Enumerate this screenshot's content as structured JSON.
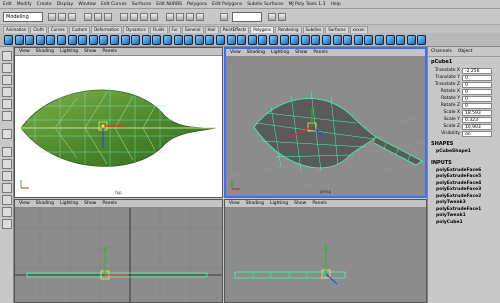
{
  "menu": [
    "Edit",
    "Modify",
    "Create",
    "Display",
    "Window",
    "Edit Curves",
    "Surfaces",
    "Edit NURBS",
    "Polygons",
    "Edit Polygons",
    "Subdiv Surfaces",
    "MJ Poly Tools 1.3",
    "Help"
  ],
  "mode": "Modeling",
  "shelf_tabs": [
    "Animation",
    "Cloth",
    "Curves",
    "Custom",
    "Deformation",
    "Dynamics",
    "Fluids",
    "Fur",
    "General",
    "Hair",
    "PaintEffects",
    "Polygons",
    "Rendering",
    "Subdivs",
    "Surfaces",
    "xxxxn"
  ],
  "active_shelf_tab": "Polygons",
  "viewport_menu": [
    "View",
    "Shading",
    "Lighting",
    "Show",
    "Panels"
  ],
  "viewports": {
    "top_left_label": "top",
    "top_right_label": "persp"
  },
  "channel_box": {
    "tabs": [
      "Channels",
      "Object"
    ],
    "object": "pCube1",
    "attributes": [
      {
        "label": "Translate X",
        "value": "-2.256"
      },
      {
        "label": "Translate Y",
        "value": "0"
      },
      {
        "label": "Translate Z",
        "value": "0"
      },
      {
        "label": "Rotate X",
        "value": "0"
      },
      {
        "label": "Rotate Y",
        "value": "0"
      },
      {
        "label": "Rotate Z",
        "value": "0"
      },
      {
        "label": "Scale X",
        "value": "18.593"
      },
      {
        "label": "Scale Y",
        "value": "0.323"
      },
      {
        "label": "Scale Z",
        "value": "10.903"
      },
      {
        "label": "Visibility",
        "value": "on"
      }
    ],
    "shapes_header": "SHAPES",
    "shape": "pCubeShape1",
    "inputs_header": "INPUTS",
    "inputs": [
      "polyExtrudeFace6",
      "polyExtrudeFace5",
      "polyExtrudeFace4",
      "polyExtrudeFace3",
      "polyExtrudeFace2",
      "polyTweak3",
      "polyExtrudeFace1",
      "polyTweak1",
      "polyCube1"
    ]
  }
}
